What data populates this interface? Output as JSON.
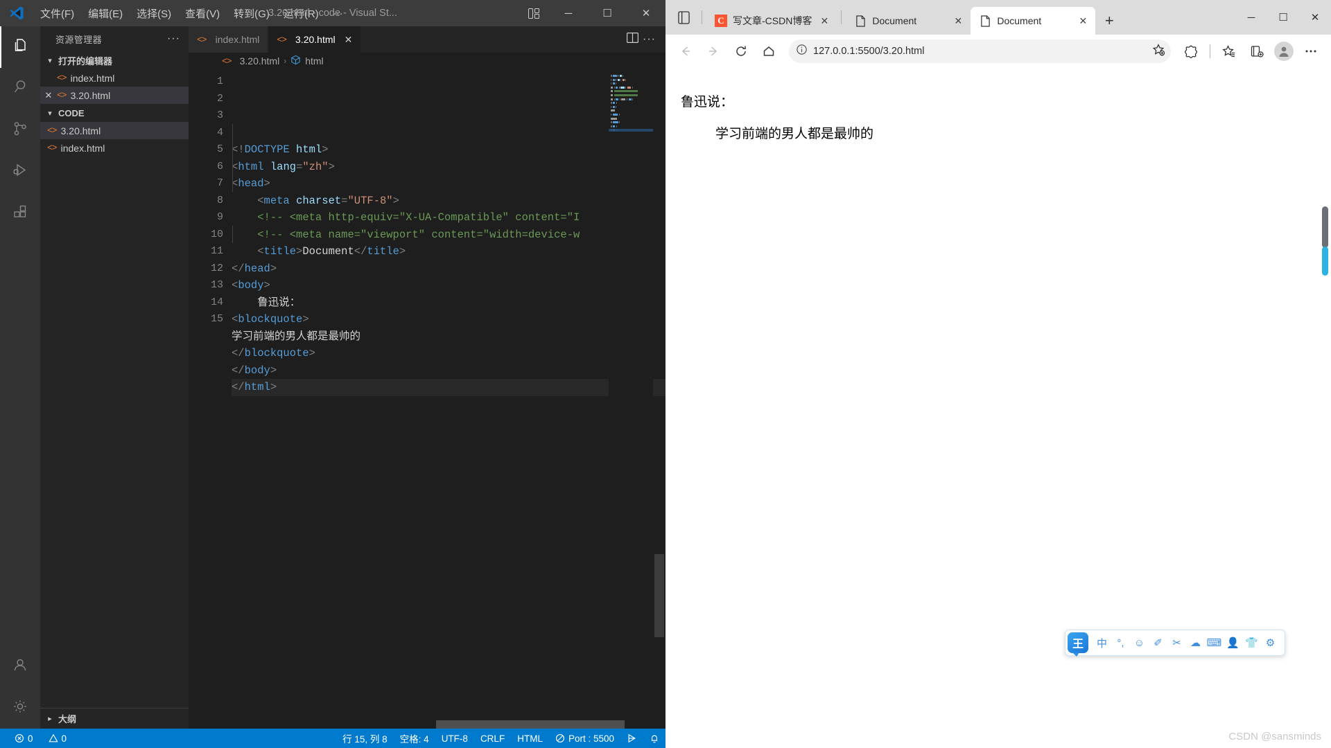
{
  "vscode": {
    "titlebar": {
      "menus": [
        "文件(F)",
        "编辑(E)",
        "选择(S)",
        "查看(V)",
        "转到(G)",
        "运行(R)",
        "···"
      ],
      "window_title": "3.20.html - code - Visual St...",
      "minimize": "─",
      "maximize": "☐",
      "close": "✕"
    },
    "activitybar": [
      {
        "name": "explorer",
        "icon": "files-icon"
      },
      {
        "name": "search",
        "icon": "search-icon"
      },
      {
        "name": "source-control",
        "icon": "source-control-icon"
      },
      {
        "name": "run-debug",
        "icon": "run-debug-icon"
      },
      {
        "name": "extensions",
        "icon": "extensions-icon"
      },
      {
        "name": "accounts",
        "icon": "account-icon"
      },
      {
        "name": "settings",
        "icon": "gear-icon"
      }
    ],
    "sidebar": {
      "title": "资源管理器",
      "more": "···",
      "open_editors": {
        "label": "打开的编辑器",
        "items": [
          {
            "name": "index.html",
            "selected": false,
            "has_close": false
          },
          {
            "name": "3.20.html",
            "selected": true,
            "has_close": true
          }
        ]
      },
      "folder": {
        "label": "CODE",
        "items": [
          {
            "name": "3.20.html",
            "selected": true
          },
          {
            "name": "index.html",
            "selected": false
          }
        ]
      },
      "outline_label": "大纲"
    },
    "tabs": [
      {
        "label": "index.html",
        "active": false,
        "close": ""
      },
      {
        "label": "3.20.html",
        "active": true,
        "close": "✕"
      }
    ],
    "breadcrumb": {
      "file": "3.20.html",
      "separator": "›",
      "symbol": "html"
    },
    "editor": {
      "line_numbers": [
        1,
        2,
        3,
        4,
        5,
        6,
        7,
        8,
        9,
        10,
        11,
        12,
        13,
        14,
        15
      ],
      "lines": [
        [
          {
            "t": "punct",
            "v": "<!"
          },
          {
            "t": "doctype",
            "v": "DOCTYPE"
          },
          {
            "t": "txt",
            "v": " "
          },
          {
            "t": "name",
            "v": "html"
          },
          {
            "t": "punct",
            "v": ">"
          }
        ],
        [
          {
            "t": "punct",
            "v": "<"
          },
          {
            "t": "tag",
            "v": "html"
          },
          {
            "t": "txt",
            "v": " "
          },
          {
            "t": "attr",
            "v": "lang"
          },
          {
            "t": "punct",
            "v": "="
          },
          {
            "t": "str",
            "v": "\"zh\""
          },
          {
            "t": "punct",
            "v": ">"
          }
        ],
        [
          {
            "t": "punct",
            "v": "<"
          },
          {
            "t": "tag",
            "v": "head"
          },
          {
            "t": "punct",
            "v": ">"
          }
        ],
        [
          {
            "t": "txt",
            "v": "    "
          },
          {
            "t": "punct",
            "v": "<"
          },
          {
            "t": "tag",
            "v": "meta"
          },
          {
            "t": "txt",
            "v": " "
          },
          {
            "t": "attr",
            "v": "charset"
          },
          {
            "t": "punct",
            "v": "="
          },
          {
            "t": "str",
            "v": "\"UTF-8\""
          },
          {
            "t": "punct",
            "v": ">"
          }
        ],
        [
          {
            "t": "txt",
            "v": "    "
          },
          {
            "t": "cmt",
            "v": "<!-- <meta http-equiv=\"X-UA-Compatible\" content=\"I"
          }
        ],
        [
          {
            "t": "txt",
            "v": "    "
          },
          {
            "t": "cmt",
            "v": "<!-- <meta name=\"viewport\" content=\"width=device-w"
          }
        ],
        [
          {
            "t": "txt",
            "v": "    "
          },
          {
            "t": "punct",
            "v": "<"
          },
          {
            "t": "tag",
            "v": "title"
          },
          {
            "t": "punct",
            "v": ">"
          },
          {
            "t": "txt",
            "v": "Document"
          },
          {
            "t": "punct",
            "v": "</"
          },
          {
            "t": "tag",
            "v": "title"
          },
          {
            "t": "punct",
            "v": ">"
          }
        ],
        [
          {
            "t": "punct",
            "v": "</"
          },
          {
            "t": "tag",
            "v": "head"
          },
          {
            "t": "punct",
            "v": ">"
          }
        ],
        [
          {
            "t": "punct",
            "v": "<"
          },
          {
            "t": "tag",
            "v": "body"
          },
          {
            "t": "punct",
            "v": ">"
          }
        ],
        [
          {
            "t": "txt",
            "v": "    鲁迅说："
          }
        ],
        [
          {
            "t": "punct",
            "v": "<"
          },
          {
            "t": "tag",
            "v": "blockquote"
          },
          {
            "t": "punct",
            "v": ">"
          }
        ],
        [
          {
            "t": "txt",
            "v": "学习前端的男人都是最帅的"
          }
        ],
        [
          {
            "t": "punct",
            "v": "</"
          },
          {
            "t": "tag",
            "v": "blockquote"
          },
          {
            "t": "punct",
            "v": ">"
          }
        ],
        [
          {
            "t": "punct",
            "v": "</"
          },
          {
            "t": "tag",
            "v": "body"
          },
          {
            "t": "punct",
            "v": ">"
          }
        ],
        [
          {
            "t": "punct",
            "v": "</"
          },
          {
            "t": "tag",
            "v": "html"
          },
          {
            "t": "punct",
            "v": ">"
          }
        ]
      ],
      "current_line_index": 14
    },
    "statusbar": {
      "errors": "0",
      "warnings": "0",
      "cursor": "行 15, 列 8",
      "spaces": "空格: 4",
      "encoding": "UTF-8",
      "eol": "CRLF",
      "language": "HTML",
      "liveserver": "Port : 5500"
    }
  },
  "browser": {
    "tabs": [
      {
        "label": "写文章-CSDN博客",
        "active": false,
        "favicon": "csdn-icon",
        "close": "✕"
      },
      {
        "label": "Document",
        "active": false,
        "favicon": "page-icon",
        "close": "✕"
      },
      {
        "label": "Document",
        "active": true,
        "favicon": "page-icon",
        "close": "✕"
      }
    ],
    "newtab_label": "+",
    "window": {
      "minimize": "─",
      "maximize": "☐",
      "close": "✕"
    },
    "toolbar": {
      "back": "←",
      "forward": "→",
      "refresh": "↻",
      "home": "⌂",
      "url": "127.0.0.1:5500/3.20.html",
      "url_host": "127.0.0.1",
      "url_rest": ":5500/3.20.html"
    },
    "page": {
      "intro": "鲁迅说：",
      "quote": "学习前端的男人都是最帅的"
    },
    "ime": {
      "logo": "王",
      "buttons": [
        "中",
        "°,",
        "☺",
        "✐",
        "✂",
        "☁",
        "⌨",
        "👤",
        "👕",
        "⚙"
      ]
    },
    "watermark": "CSDN @sansminds"
  }
}
